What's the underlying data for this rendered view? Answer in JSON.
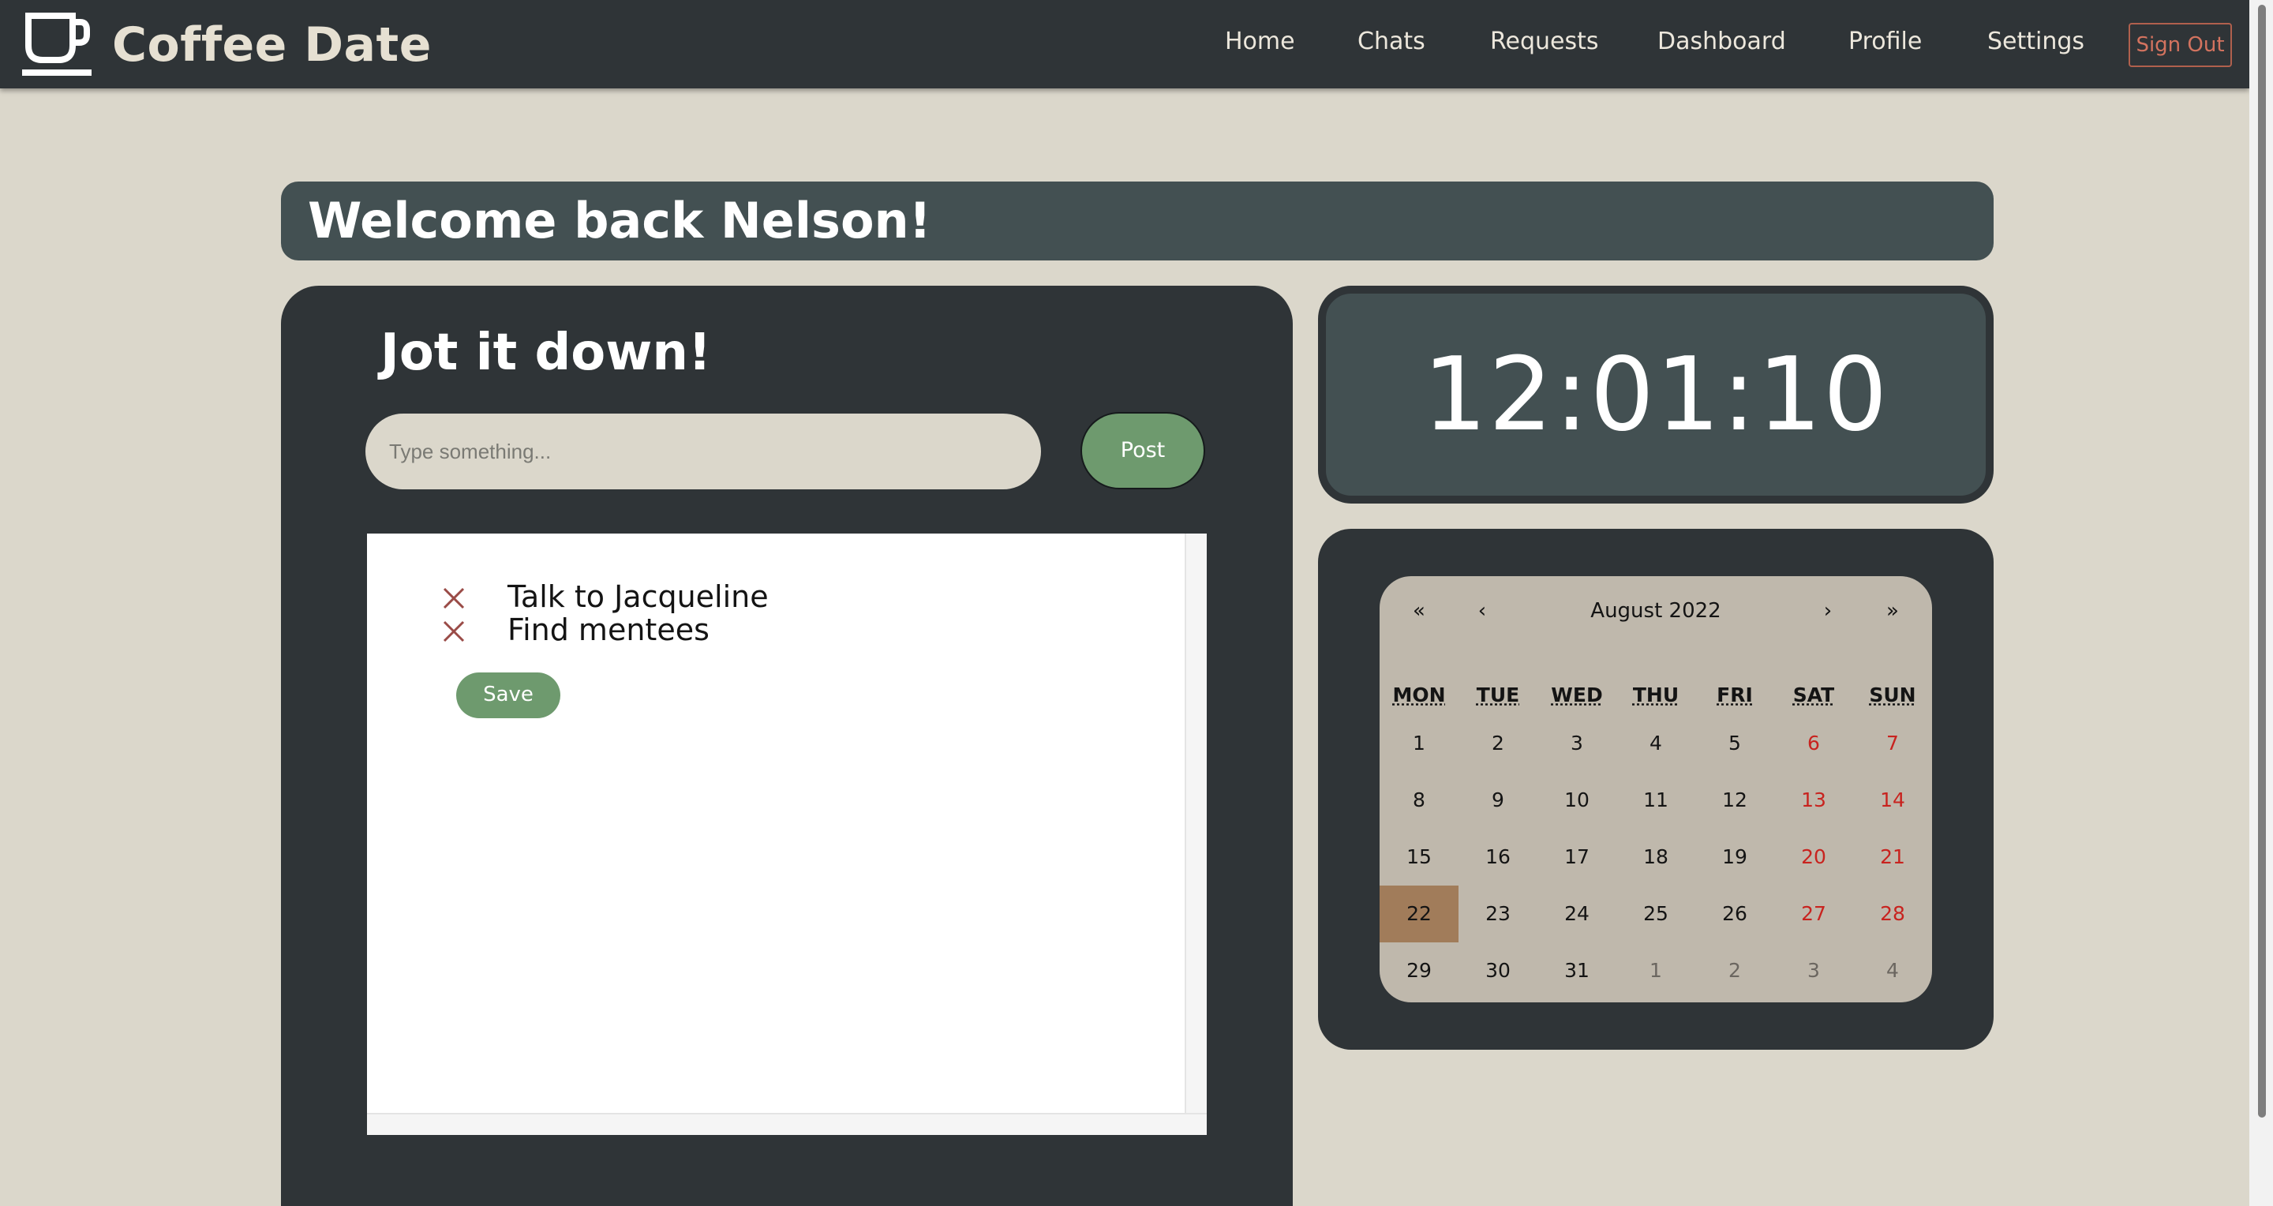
{
  "navbar": {
    "brand": "Coffee Date",
    "links": [
      "Home",
      "Chats",
      "Requests",
      "Dashboard",
      "Profile",
      "Settings"
    ],
    "sign_out": "Sign Out"
  },
  "welcome": {
    "text": "Welcome back Nelson!"
  },
  "jot": {
    "title": "Jot it down!",
    "input_placeholder": "Type something...",
    "post_label": "Post",
    "notes": [
      {
        "text": "Talk to Jacqueline"
      },
      {
        "text": "Find mentees"
      }
    ],
    "save_label": "Save"
  },
  "clock": {
    "time": "12:01:10"
  },
  "calendar": {
    "month_label": "August 2022",
    "nav": {
      "prev_year": "«",
      "prev_month": "‹",
      "next_month": "›",
      "next_year": "»"
    },
    "weekdays": [
      "MON",
      "TUE",
      "WED",
      "THU",
      "FRI",
      "SAT",
      "SUN"
    ],
    "days": [
      "1",
      "2",
      "3",
      "4",
      "5",
      "6",
      "7",
      "8",
      "9",
      "10",
      "11",
      "12",
      "13",
      "14",
      "15",
      "16",
      "17",
      "18",
      "19",
      "20",
      "21",
      "22",
      "23",
      "24",
      "25",
      "26",
      "27",
      "28",
      "29",
      "30",
      "31",
      "1",
      "2",
      "3",
      "4"
    ],
    "current_month_day_count": 31,
    "selected_day": "22"
  },
  "colors": {
    "background": "#dbd7cb",
    "dark_panel": "#2f3437",
    "slate_panel": "#435052",
    "accent_green": "#6e9a6e",
    "weekend_red": "#c8231f",
    "selected_day": "#a17c5a"
  }
}
